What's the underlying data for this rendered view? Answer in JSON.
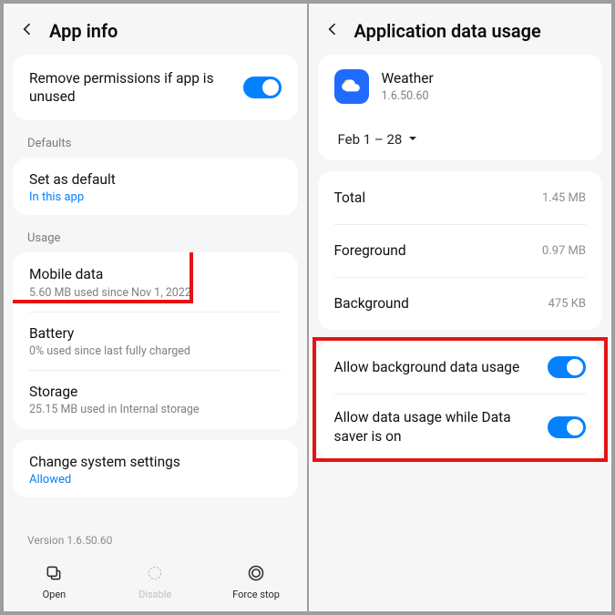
{
  "left": {
    "title": "App info",
    "remove_perm": "Remove permissions if app is unused",
    "defaults_head": "Defaults",
    "set_default": "Set as default",
    "in_this_app": "In this app",
    "usage_head": "Usage",
    "mobile_data": "Mobile data",
    "mobile_data_sub": "5.60 MB used since Nov 1, 2022",
    "battery": "Battery",
    "battery_sub": "0% used since last fully charged",
    "storage": "Storage",
    "storage_sub": "25.15 MB used in Internal storage",
    "change_sys": "Change system settings",
    "allowed": "Allowed",
    "version": "Version 1.6.50.60",
    "open": "Open",
    "disable": "Disable",
    "force_stop": "Force stop"
  },
  "right": {
    "title": "Application data usage",
    "app_name": "Weather",
    "app_ver": "1.6.50.60",
    "date_range": "Feb 1 – 28",
    "total": "Total",
    "total_val": "1.45 MB",
    "foreground": "Foreground",
    "foreground_val": "0.97 MB",
    "background": "Background",
    "background_val": "475 KB",
    "allow_bg": "Allow background data usage",
    "allow_ds": "Allow data usage while Data saver is on"
  }
}
